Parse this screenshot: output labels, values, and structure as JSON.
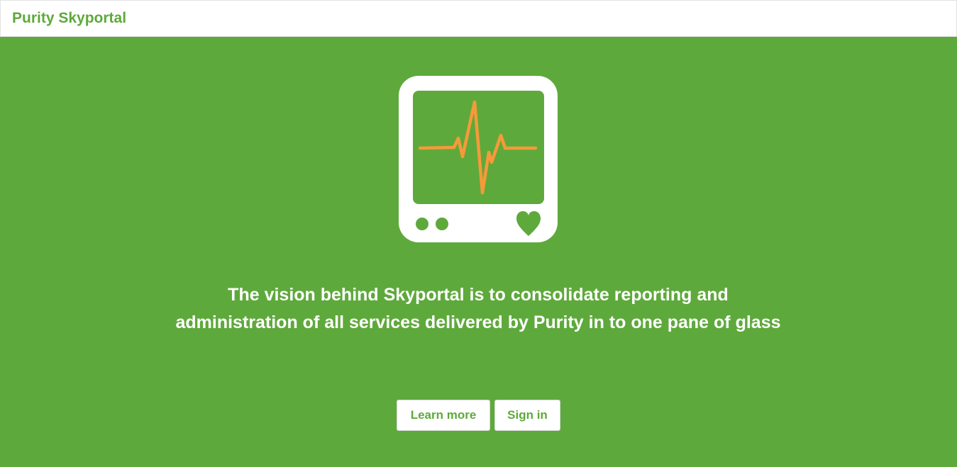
{
  "navbar": {
    "brand": "Purity Skyportal"
  },
  "hero": {
    "icon": "heart-monitor-icon",
    "tagline": "The vision behind Skyportal is to consolidate reporting and administration of all services delivered by Purity in to one pane of glass",
    "buttons": {
      "learn_more": "Learn more",
      "sign_in": "Sign in"
    }
  },
  "colors": {
    "brand_green": "#5ea93b",
    "pulse_orange": "#f59a3a",
    "white": "#ffffff"
  }
}
